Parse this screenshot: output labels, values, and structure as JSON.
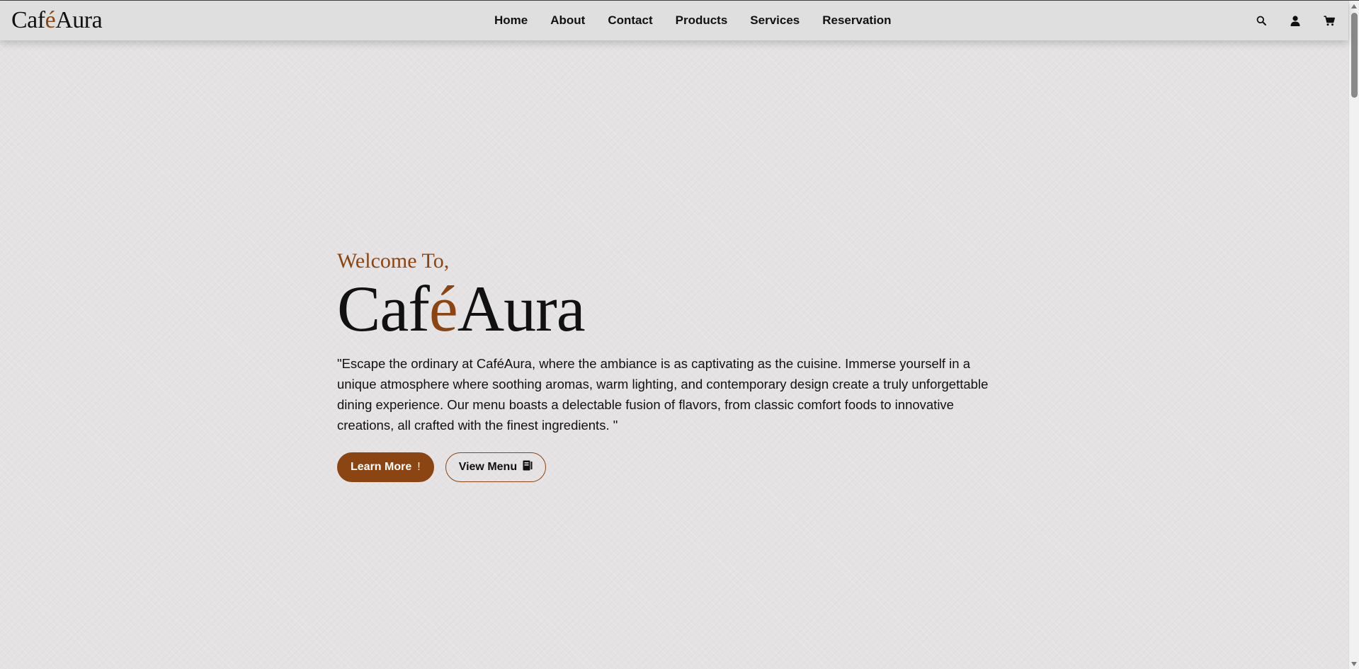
{
  "brand": {
    "part1": "Caf",
    "accent": "é",
    "part2": "Aura"
  },
  "nav": {
    "items": [
      {
        "label": "Home"
      },
      {
        "label": "About"
      },
      {
        "label": "Contact"
      },
      {
        "label": "Products"
      },
      {
        "label": "Services"
      },
      {
        "label": "Reservation"
      }
    ]
  },
  "header_icons": [
    "search-icon",
    "user-icon",
    "cart-icon"
  ],
  "hero": {
    "welcome": "Welcome To,",
    "title": {
      "part1": "Caf",
      "accent": "é",
      "part2": "Aura"
    },
    "description": "\"Escape the ordinary at CaféAura, where the ambiance is as captivating as the cuisine. Immerse yourself in a unique atmosphere where soothing aromas, warm lighting, and contemporary design create a truly unforgettable dining experience. Our menu boasts a delectable fusion of flavors, from classic comfort foods to innovative creations, all crafted with the finest ingredients. \"",
    "learn_more": "Learn More",
    "view_menu": "View Menu"
  },
  "colors": {
    "accent": "#8b4513",
    "background": "#e4e2e3",
    "text": "#111111"
  }
}
